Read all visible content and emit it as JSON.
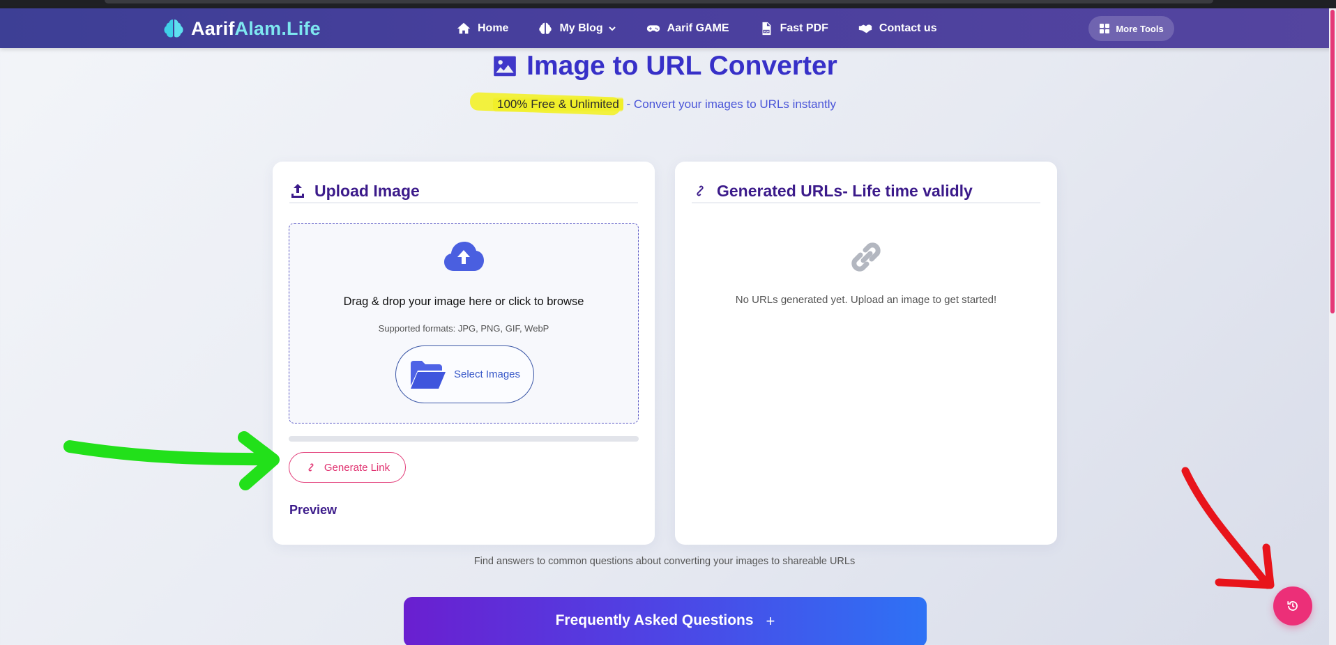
{
  "brand": {
    "part1": "Aarif",
    "part2": "Alam.Life"
  },
  "nav": {
    "items": [
      {
        "label": "Home",
        "icon": "home-icon"
      },
      {
        "label": "My Blog",
        "icon": "brain-icon",
        "has_dropdown": true
      },
      {
        "label": "Aarif GAME",
        "icon": "gamepad-icon"
      },
      {
        "label": "Fast PDF",
        "icon": "pdf-icon"
      },
      {
        "label": "Contact us",
        "icon": "handshake-icon"
      }
    ],
    "more_tools": "More Tools"
  },
  "hero": {
    "title": "Image to URL Converter",
    "subtitle_highlight": "100% Free & Unlimited",
    "subtitle_rest": "- Convert your images to URLs instantly"
  },
  "upload_card": {
    "title": "Upload Image",
    "drop_text": "Drag & drop your image here or click to browse",
    "formats": "Supported formats: JPG, PNG, GIF, WebP",
    "select_button": "Select Images",
    "generate_button": "Generate Link",
    "preview_label": "Preview",
    "progress": 0
  },
  "urls_card": {
    "title_part1": "Generated URLs-",
    "title_part2": "Life time validly",
    "empty_message": "No URLs generated yet. Upload an image to get started!"
  },
  "faq": {
    "caption": "Find answers to common questions about converting your images to shareable URLs",
    "title": "Frequently Asked Questions",
    "toggle": "+"
  },
  "colors": {
    "navbar": "#443f99",
    "accent": "#3730c8",
    "pink": "#e0306f",
    "annotation_green": "#22e01a",
    "annotation_red": "#e8141b",
    "annotation_yellow": "#f3f12a"
  }
}
